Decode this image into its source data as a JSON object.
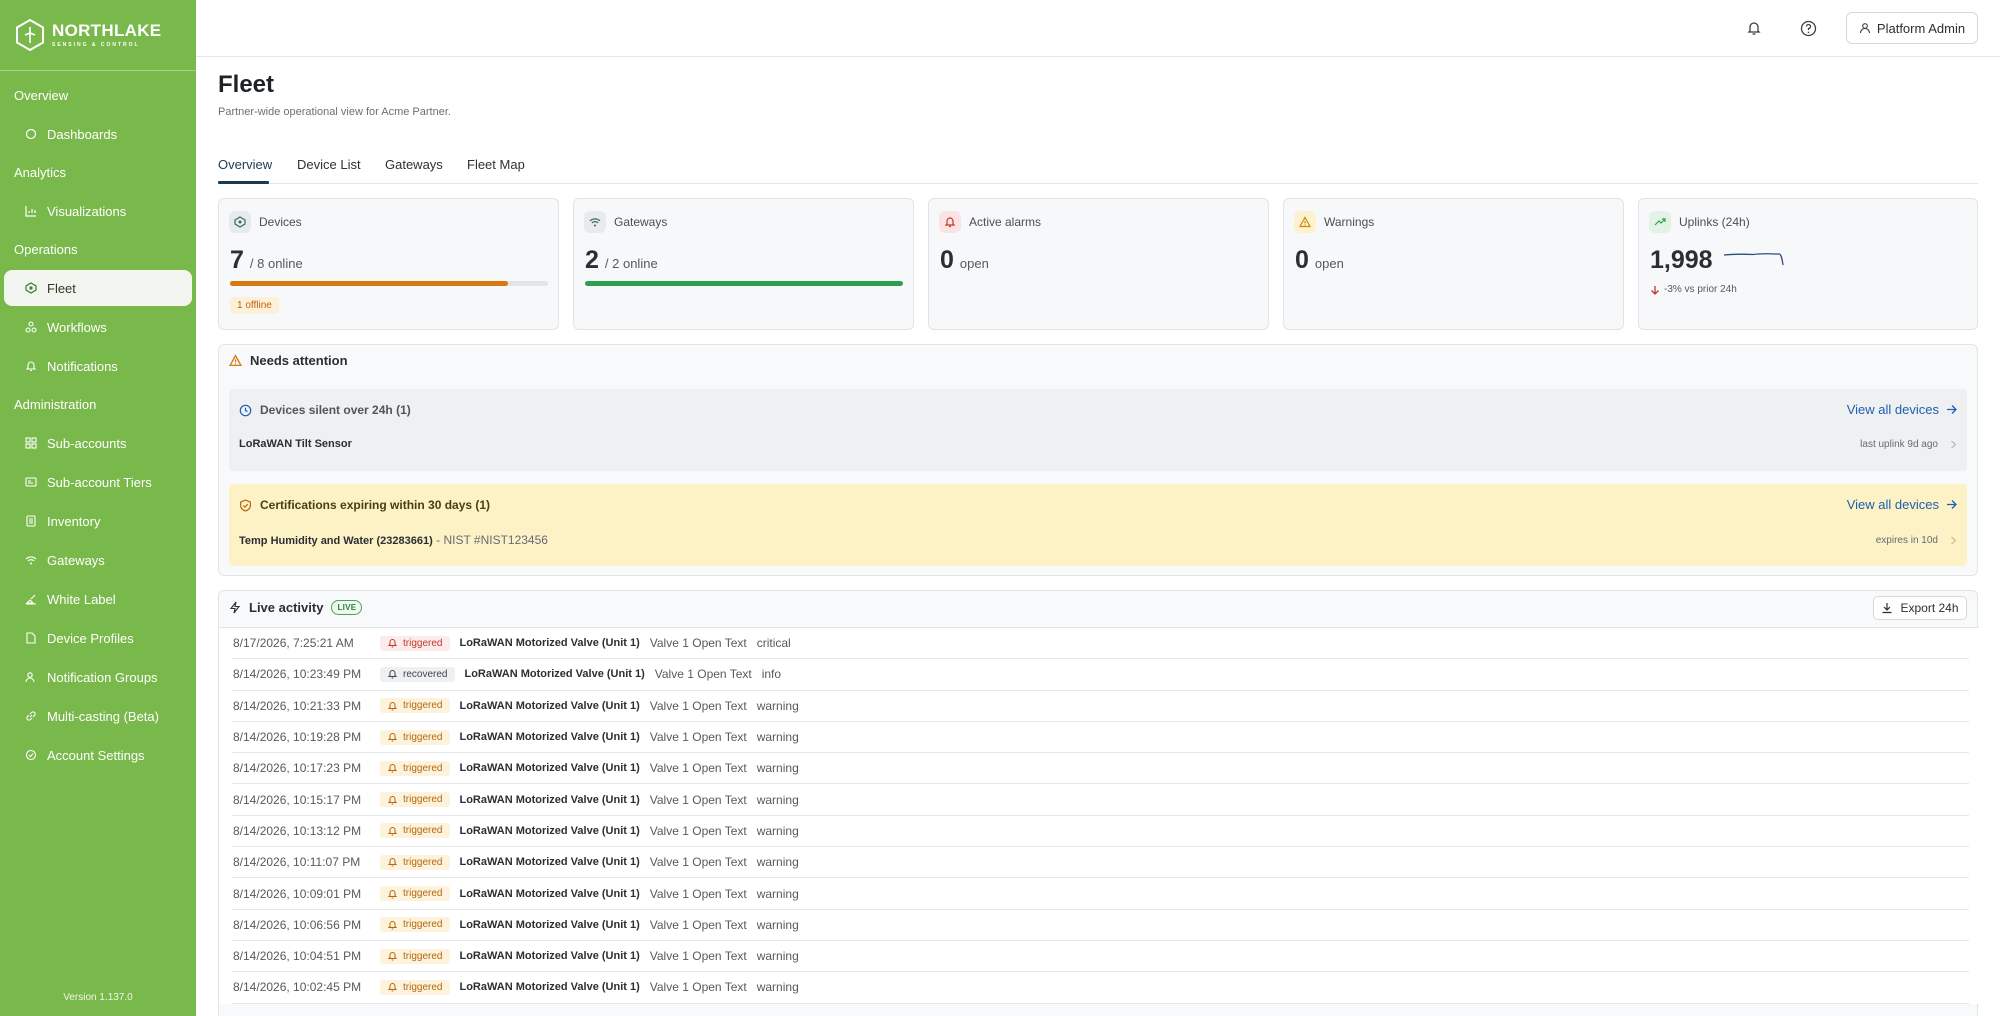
{
  "brand": {
    "name": "NORTHLAKE",
    "tagline": "SENSING & CONTROL"
  },
  "sidebar": {
    "sections": [
      "Overview",
      "Analytics",
      "Operations",
      "Administration"
    ],
    "items": [
      {
        "label": "Dashboards",
        "icon": "dashboard-icon"
      },
      {
        "label": "Visualizations",
        "icon": "chart-icon"
      },
      {
        "label": "Fleet",
        "icon": "chip-icon",
        "active": true
      },
      {
        "label": "Workflows",
        "icon": "workflow-icon"
      },
      {
        "label": "Notifications",
        "icon": "bell-icon"
      },
      {
        "label": "Sub-accounts",
        "icon": "grid-icon"
      },
      {
        "label": "Sub-account Tiers",
        "icon": "id-card-icon"
      },
      {
        "label": "Inventory",
        "icon": "clipboard-icon"
      },
      {
        "label": "Gateways",
        "icon": "wifi-icon"
      },
      {
        "label": "White Label",
        "icon": "paint-icon"
      },
      {
        "label": "Device Profiles",
        "icon": "file-icon"
      },
      {
        "label": "Notification Groups",
        "icon": "users-icon"
      },
      {
        "label": "Multi-casting (Beta)",
        "icon": "link-icon"
      },
      {
        "label": "Account Settings",
        "icon": "settings-icon"
      }
    ],
    "version": "Version 1.137.0"
  },
  "topbar": {
    "user_label": "Platform Admin"
  },
  "page": {
    "title": "Fleet",
    "subtitle": "Partner-wide operational view for Acme Partner.",
    "tabs": [
      "Overview",
      "Device List",
      "Gateways",
      "Fleet Map"
    ],
    "active_tab": "Overview"
  },
  "cards": {
    "devices": {
      "label": "Devices",
      "value": "7",
      "suffix": "/ 8 online",
      "progress": 0.875,
      "badge": "1 offline"
    },
    "gateways": {
      "label": "Gateways",
      "value": "2",
      "suffix": "/ 2 online",
      "progress": 1.0
    },
    "alarms": {
      "label": "Active alarms",
      "value": "0",
      "suffix": "open"
    },
    "warnings": {
      "label": "Warnings",
      "value": "0",
      "suffix": "open"
    },
    "uplinks": {
      "label": "Uplinks (24h)",
      "value": "1,998",
      "trend": "-3% vs prior 24h"
    }
  },
  "attention": {
    "title": "Needs attention",
    "silent": {
      "title": "Devices silent over 24h (1)",
      "link": "View all devices",
      "device": "LoRaWAN Tilt Sensor",
      "meta": "last uplink 9d ago"
    },
    "certs": {
      "title": "Certifications expiring within 30 days (1)",
      "link": "View all devices",
      "device": "Temp Humidity and Water (23283661)",
      "detail": " - NIST #NIST123456",
      "meta": "expires in 10d"
    }
  },
  "activity": {
    "title": "Live activity",
    "badge": "LIVE",
    "export_label": "Export 24h",
    "rows": [
      {
        "time": "8/17/2026, 7:25:21 AM",
        "status": "triggered",
        "kind": "critical",
        "device": "LoRaWAN Motorized Valve (Unit 1)",
        "message": "Valve 1 Open Text",
        "severity": "critical"
      },
      {
        "time": "8/14/2026, 10:23:49 PM",
        "status": "recovered",
        "kind": "info",
        "device": "LoRaWAN Motorized Valve (Unit 1)",
        "message": "Valve 1 Open Text",
        "severity": "info"
      },
      {
        "time": "8/14/2026, 10:21:33 PM",
        "status": "triggered",
        "kind": "warning",
        "device": "LoRaWAN Motorized Valve (Unit 1)",
        "message": "Valve 1 Open Text",
        "severity": "warning"
      },
      {
        "time": "8/14/2026, 10:19:28 PM",
        "status": "triggered",
        "kind": "warning",
        "device": "LoRaWAN Motorized Valve (Unit 1)",
        "message": "Valve 1 Open Text",
        "severity": "warning"
      },
      {
        "time": "8/14/2026, 10:17:23 PM",
        "status": "triggered",
        "kind": "warning",
        "device": "LoRaWAN Motorized Valve (Unit 1)",
        "message": "Valve 1 Open Text",
        "severity": "warning"
      },
      {
        "time": "8/14/2026, 10:15:17 PM",
        "status": "triggered",
        "kind": "warning",
        "device": "LoRaWAN Motorized Valve (Unit 1)",
        "message": "Valve 1 Open Text",
        "severity": "warning"
      },
      {
        "time": "8/14/2026, 10:13:12 PM",
        "status": "triggered",
        "kind": "warning",
        "device": "LoRaWAN Motorized Valve (Unit 1)",
        "message": "Valve 1 Open Text",
        "severity": "warning"
      },
      {
        "time": "8/14/2026, 10:11:07 PM",
        "status": "triggered",
        "kind": "warning",
        "device": "LoRaWAN Motorized Valve (Unit 1)",
        "message": "Valve 1 Open Text",
        "severity": "warning"
      },
      {
        "time": "8/14/2026, 10:09:01 PM",
        "status": "triggered",
        "kind": "warning",
        "device": "LoRaWAN Motorized Valve (Unit 1)",
        "message": "Valve 1 Open Text",
        "severity": "warning"
      },
      {
        "time": "8/14/2026, 10:06:56 PM",
        "status": "triggered",
        "kind": "warning",
        "device": "LoRaWAN Motorized Valve (Unit 1)",
        "message": "Valve 1 Open Text",
        "severity": "warning"
      },
      {
        "time": "8/14/2026, 10:04:51 PM",
        "status": "triggered",
        "kind": "warning",
        "device": "LoRaWAN Motorized Valve (Unit 1)",
        "message": "Valve 1 Open Text",
        "severity": "warning"
      },
      {
        "time": "8/14/2026, 10:02:45 PM",
        "status": "triggered",
        "kind": "warning",
        "device": "LoRaWAN Motorized Valve (Unit 1)",
        "message": "Valve 1 Open Text",
        "severity": "warning"
      }
    ]
  },
  "colors": {
    "sidebar": "#79b84a",
    "accent_blue": "#1f5fb0",
    "progress_orange": "#d8780f",
    "progress_green": "#2e9e4f",
    "cert_bg": "#fdf1c6"
  }
}
